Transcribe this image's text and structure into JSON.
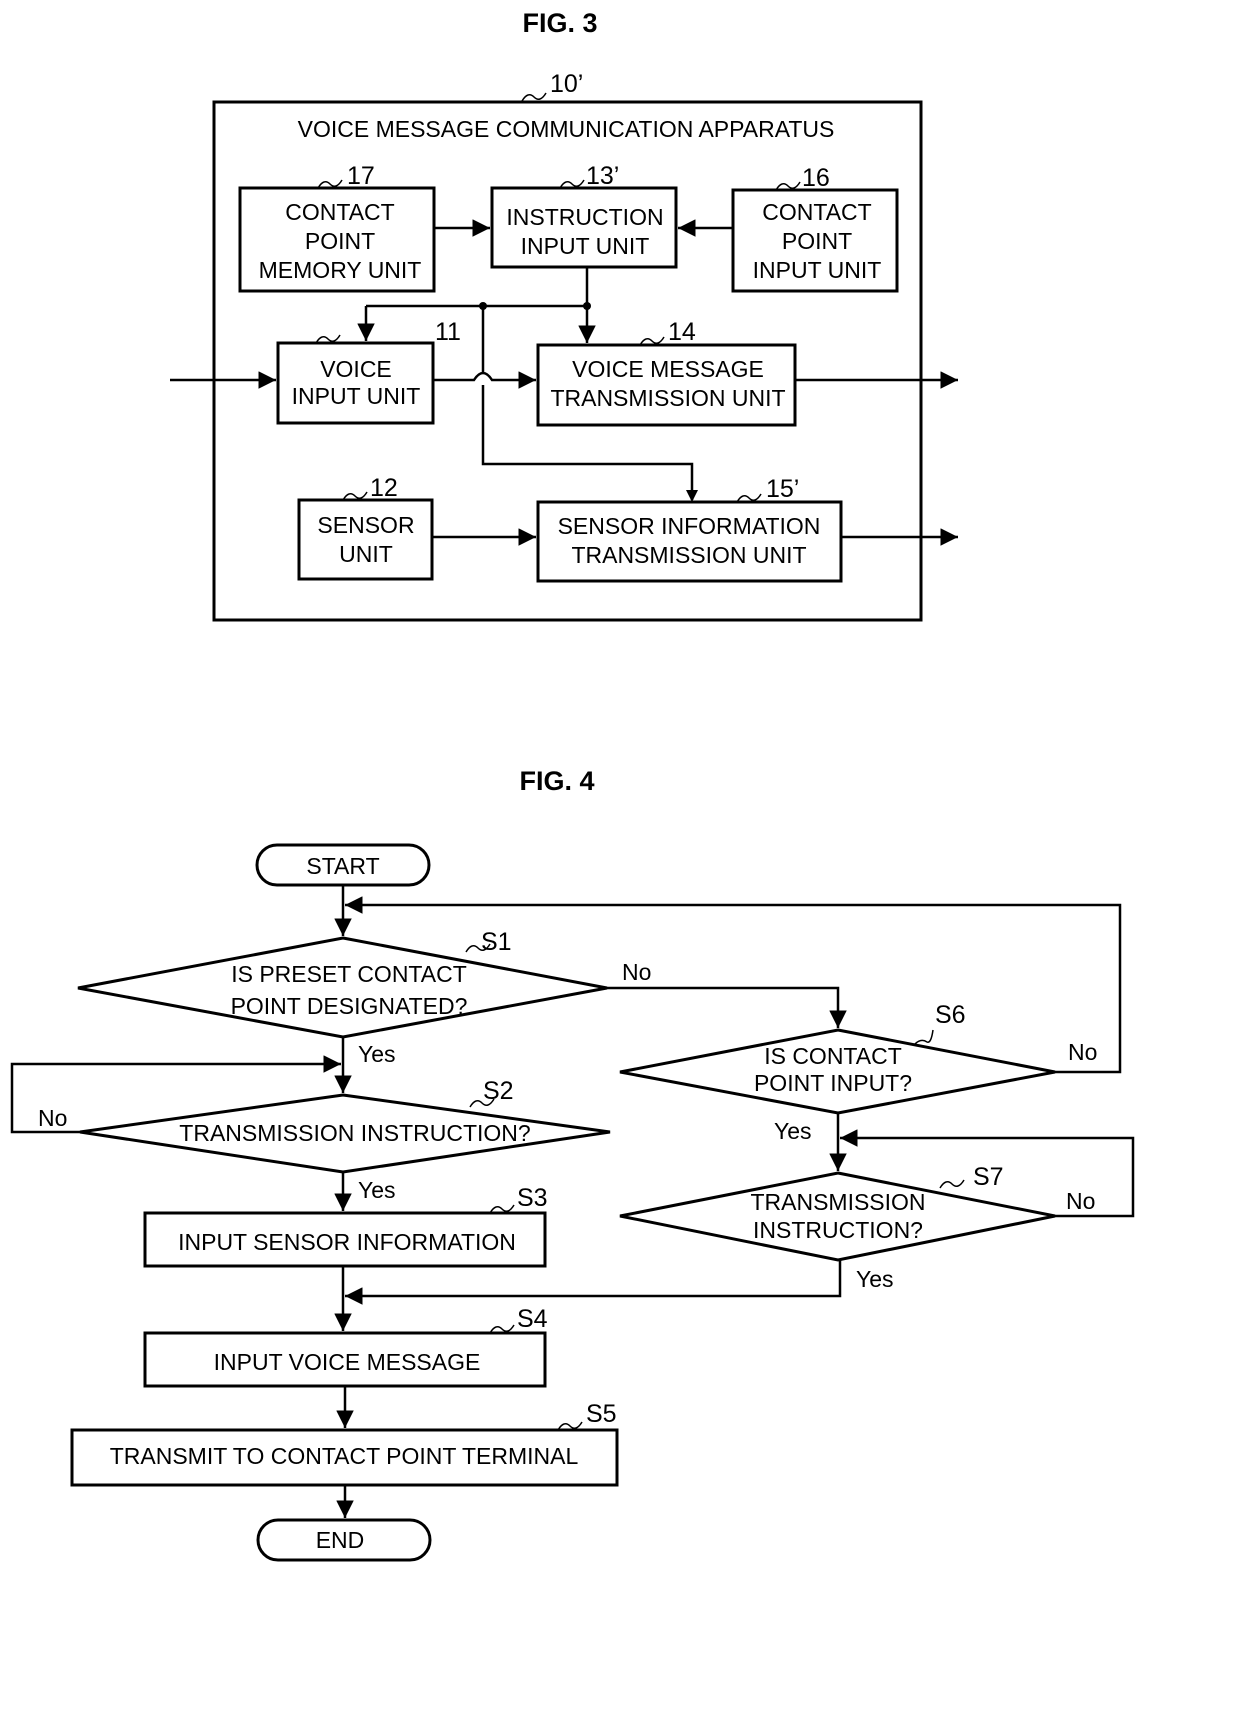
{
  "fig3": {
    "title": "FIG. 3",
    "apparatus": {
      "ref": "10’",
      "label": "VOICE MESSAGE COMMUNICATION APPARATUS"
    },
    "blocks": [
      {
        "id": "contact-point-memory-unit",
        "ref": "17",
        "lines": [
          "CONTACT",
          "POINT",
          "MEMORY UNIT"
        ]
      },
      {
        "id": "instruction-input-unit",
        "ref": "13’",
        "lines": [
          "INSTRUCTION",
          "INPUT UNIT"
        ]
      },
      {
        "id": "contact-point-input-unit",
        "ref": "16",
        "lines": [
          "CONTACT",
          "POINT",
          "INPUT UNIT"
        ]
      },
      {
        "id": "voice-input-unit",
        "ref": "11",
        "lines": [
          "VOICE",
          "INPUT UNIT"
        ]
      },
      {
        "id": "voice-message-transmission-unit",
        "ref": "14",
        "lines": [
          "VOICE MESSAGE",
          "TRANSMISSION UNIT"
        ]
      },
      {
        "id": "sensor-unit",
        "ref": "12",
        "lines": [
          "SENSOR",
          "UNIT"
        ]
      },
      {
        "id": "sensor-information-transmission-unit",
        "ref": "15’",
        "lines": [
          "SENSOR INFORMATION",
          "TRANSMISSION UNIT"
        ]
      }
    ]
  },
  "fig4": {
    "title": "FIG. 4",
    "start": "START",
    "end": "END",
    "steps": [
      {
        "id": "S1",
        "type": "decision",
        "lines": [
          "IS PRESET CONTACT",
          "POINT DESIGNATED?"
        ]
      },
      {
        "id": "S2",
        "type": "decision",
        "lines": [
          "TRANSMISSION INSTRUCTION?"
        ]
      },
      {
        "id": "S3",
        "type": "process",
        "lines": [
          "INPUT SENSOR INFORMATION"
        ]
      },
      {
        "id": "S4",
        "type": "process",
        "lines": [
          "INPUT VOICE MESSAGE"
        ]
      },
      {
        "id": "S5",
        "type": "process",
        "lines": [
          "TRANSMIT TO CONTACT POINT TERMINAL"
        ]
      },
      {
        "id": "S6",
        "type": "decision",
        "lines": [
          "IS CONTACT",
          "POINT INPUT?"
        ]
      },
      {
        "id": "S7",
        "type": "decision",
        "lines": [
          "TRANSMISSION",
          "INSTRUCTION?"
        ]
      }
    ],
    "edge_labels": {
      "s1_yes": "Yes",
      "s1_no": "No",
      "s2_yes": "Yes",
      "s2_no": "No",
      "s6_yes": "Yes",
      "s6_no": "No",
      "s7_yes": "Yes",
      "s7_no": "No"
    }
  }
}
